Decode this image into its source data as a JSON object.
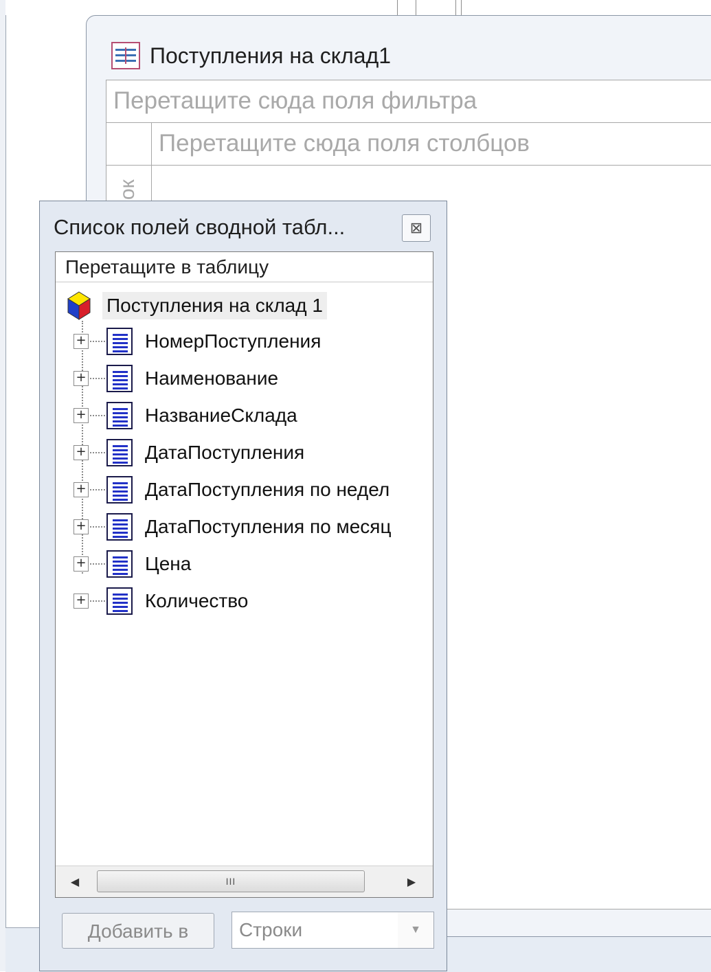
{
  "window": {
    "title": "Поступления на склад1"
  },
  "pivot": {
    "filter_drop_text": "Перетащите сюда поля фильтра",
    "column_drop_text": "Перетащите сюда поля столбцов",
    "row_drop_text_fragment": "ок"
  },
  "field_list": {
    "title": "Список полей сводной табл...",
    "close_glyph": "⊠",
    "hint": "Перетащите в таблицу",
    "root": {
      "label": "Поступления на склад 1",
      "icon": "cube-icon"
    },
    "fields": [
      {
        "label": "НомерПоступления",
        "icon": "field-list-icon",
        "expand": "+"
      },
      {
        "label": "Наименование",
        "icon": "field-list-icon",
        "expand": "+"
      },
      {
        "label": "НазваниеСклада",
        "icon": "field-list-icon",
        "expand": "+"
      },
      {
        "label": "ДатаПоступления",
        "icon": "field-list-icon",
        "expand": "+"
      },
      {
        "label": "ДатаПоступления по недел",
        "icon": "field-list-icon",
        "expand": "+"
      },
      {
        "label": "ДатаПоступления по месяц",
        "icon": "field-list-icon",
        "expand": "+"
      },
      {
        "label": "Цена",
        "icon": "field-list-icon",
        "expand": "+"
      },
      {
        "label": "Количество",
        "icon": "field-list-icon",
        "expand": "+"
      }
    ],
    "scrollbar": {
      "left_arrow": "◀",
      "right_arrow": "▶",
      "thumb_grip": "III"
    },
    "add_button_label": "Добавить в",
    "area_select_value": "Строки",
    "area_select_arrow": "▼"
  },
  "colors": {
    "drop_zone_text": "#a9a9a9",
    "field_icon_lines": "#2231c7",
    "dialog_background": "#e3e9f2"
  }
}
